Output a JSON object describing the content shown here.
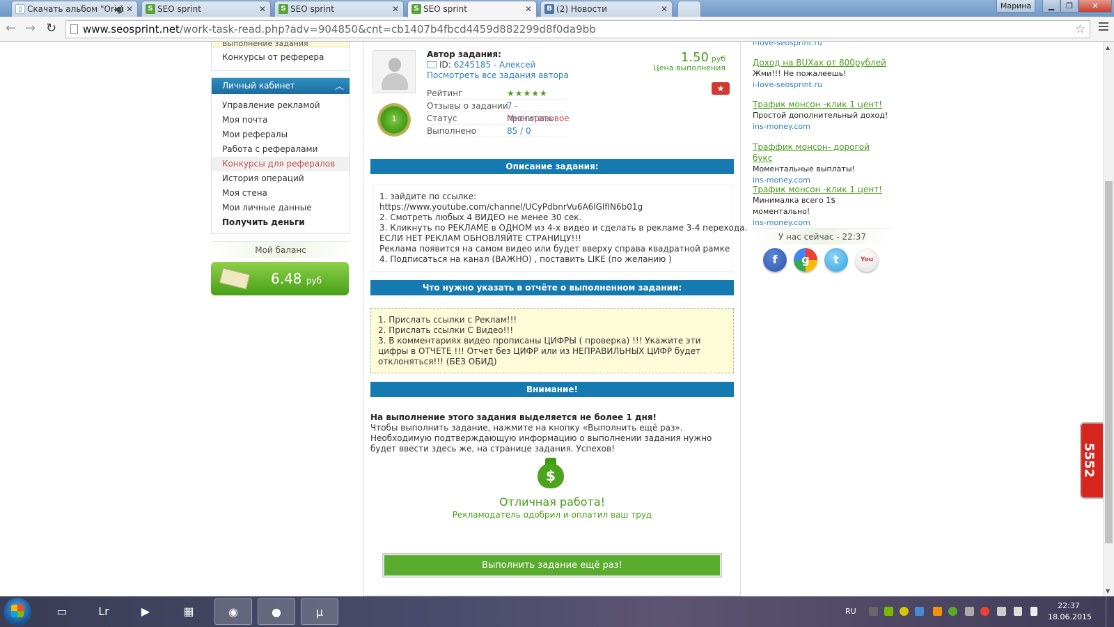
{
  "browser": {
    "tabs": [
      {
        "title": "Скачать альбом \"Origi",
        "favicon": "bookmark-icon",
        "active": false
      },
      {
        "title": "SEO sprint",
        "favicon": "s-icon",
        "active": false
      },
      {
        "title": "SEO sprint",
        "favicon": "s-icon",
        "active": false
      },
      {
        "title": "SEO sprint",
        "favicon": "s-icon",
        "active": true
      },
      {
        "title": "(2) Новости",
        "favicon": "vk-icon",
        "active": false
      }
    ],
    "user": "Марина",
    "url_host": "www.seosprint.net",
    "url_path": "/work-task-read.php?adv=904850&cnt=cb1407b4fbcd4459d882299d8f0da9bb"
  },
  "sidebar": {
    "top_items": [
      "Выполнение задания",
      "Конкурсы от реферера"
    ],
    "cabinet_title": "Личный кабинет",
    "cabinet_items": [
      {
        "label": "Управление рекламой",
        "style": "normal"
      },
      {
        "label": "Моя почта",
        "style": "normal"
      },
      {
        "label": "Мои рефералы",
        "style": "normal"
      },
      {
        "label": "Работа с рефералами",
        "style": "normal"
      },
      {
        "label": "Конкурсы для рефералов",
        "style": "highlight"
      },
      {
        "label": "История операций",
        "style": "normal"
      },
      {
        "label": "Моя стена",
        "style": "normal"
      },
      {
        "label": "Мои личные данные",
        "style": "normal"
      },
      {
        "label": "Получить деньги",
        "style": "bold"
      }
    ],
    "balance_title": "Мой баланс",
    "balance_value": "6.48",
    "balance_currency": "руб"
  },
  "task": {
    "author_label": "Автор задания:",
    "author_id_text": "ID: ",
    "author_id": "6245185 - Алексей",
    "author_all": "Посмотреть все задания автора",
    "price": "1.50",
    "price_currency": "руб",
    "price_label": "Цена выполнения",
    "medal_number": "1",
    "stats": [
      {
        "key": "Рейтинг",
        "value": "★★★★★",
        "kind": "stars"
      },
      {
        "key": "Отзывы о задании",
        "value": "7 - прочитать",
        "kind": "rev"
      },
      {
        "key": "Статус",
        "value": "Многоразовое",
        "kind": "stat"
      },
      {
        "key": "Выполнено",
        "value": "85 / 0",
        "kind": "done"
      }
    ],
    "desc_title": "Описание задания:",
    "desc_lines": [
      "1. зайдите по ссылке:",
      "https://www.youtube.com/channel/UCyPdbnrVu6A6lGlfIN6b01g",
      "2. Смотреть любых 4 ВИДЕО не менее 30 сек.",
      "3. Кликнуть по РЕКЛАМЕ в ОДНОМ из 4-х видео и сделать в рекламе 3-4 перехода.",
      "ЕСЛИ НЕТ РЕКЛАМ ОБНОВЛЯЙТЕ СТРАНИЦУ!!!",
      "Реклама появится на самом видео или будет вверху справа квадратной рамке",
      "4. Подписаться на канал (ВАЖНО) , поставить LIKE (по желанию )"
    ],
    "report_title": "Что нужно указать в отчёте о выполненном задании:",
    "report_lines": [
      "1. Прислать ссылки с Реклам!!!",
      "2. Прислать ссылки С Видео!!!",
      "3. В комментариях видео прописаны ЦИФРЫ ( проверка) !!! Укажите эти цифры в ОТЧЕТЕ !!! Отчет без ЦИФР или из НЕПРАВИЛЬНЫХ ЦИФР будет отклоняться!!! (БЕЗ ОБИД)"
    ],
    "warn_title": "Внимание!",
    "warn_bold": "На выполнение этого задания выделяется не более 1 дня!",
    "warn_text": "Чтобы выполнить задание, нажмите на кнопку «Выполнить ещё раз». Необходимую подтверждающую информацию о выполнении задания нужно будет ввести здесь же, на странице задания. Успехов!",
    "great_title": "Отличная работа!",
    "great_sub": "Рекламодатель одобрил и оплатил ваш труд",
    "again_button": "Выполнить задание ещё раз!"
  },
  "right": {
    "top_host": "i-love-seosprint.ru",
    "ads": [
      {
        "title": "Доход на BUXах от 800рублей",
        "desc": "Жми!!! Не пожалеешь!",
        "host": "i-love-seosprint.ru"
      },
      {
        "title": "Трафик монсон -клик 1 цент!",
        "desc": "Простой дополнительный доход!",
        "host": "ins-money.com"
      },
      {
        "title": "Траффик монсон- дорогой букс",
        "desc": "Моментальные выплаты!",
        "host": "ins-money.com"
      },
      {
        "title": "Трафик монсон -клик 1 цент!",
        "desc": "Минималка всего 1$ моментально!",
        "host": "ins-money.com"
      }
    ],
    "now_label": "У нас сейчас - 22:37",
    "social": [
      "facebook-icon",
      "google-icon",
      "twitter-icon",
      "youtube-icon"
    ],
    "widget_count": "5552"
  },
  "taskbar": {
    "lang": "RU",
    "time": "22:37",
    "date": "18.06.2015",
    "apps": [
      "explorer-icon",
      "lightroom-icon",
      "media-player-icon",
      "calculator-icon",
      "chrome-icon",
      "firefox-icon",
      "utorrent-icon"
    ]
  }
}
